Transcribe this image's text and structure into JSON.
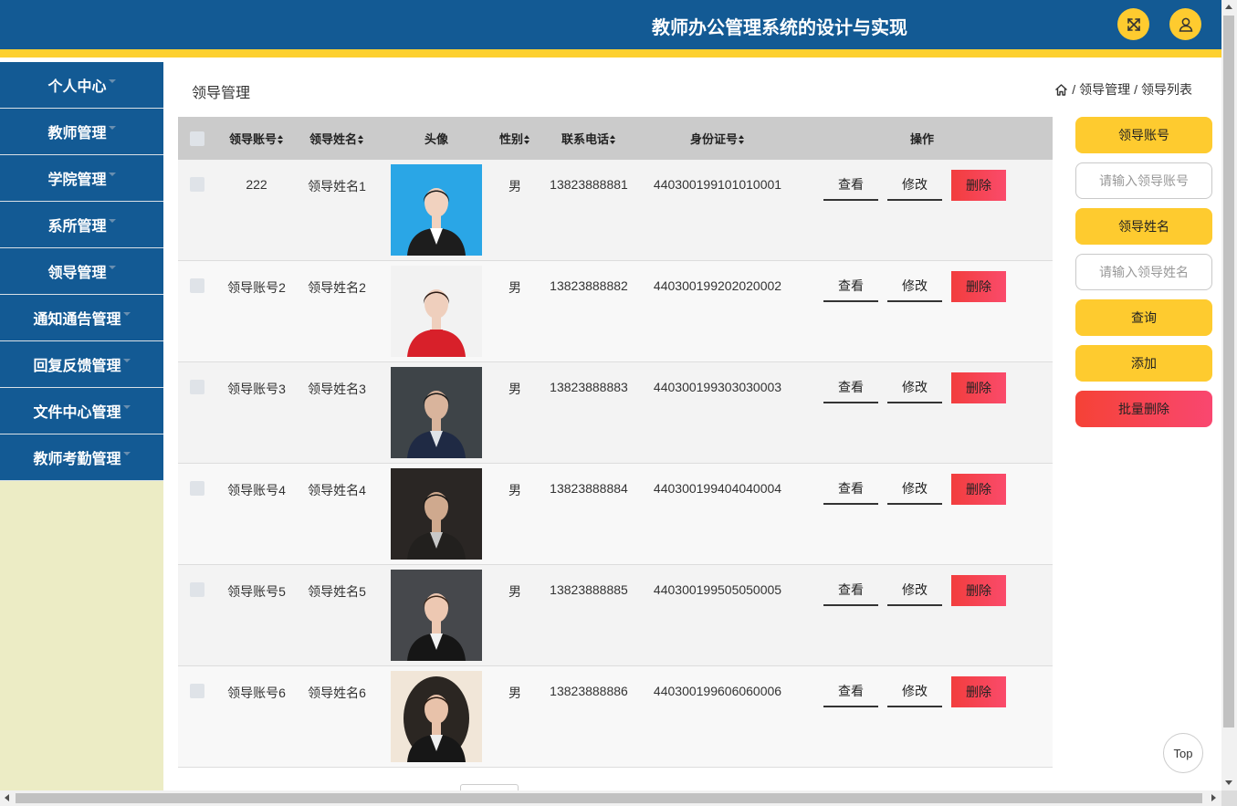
{
  "header": {
    "title": "教师办公管理系统的设计与实现",
    "fullscreen_icon": "fullscreen-icon",
    "user_icon": "user-icon",
    "bar_color": "#135a94",
    "accent_color": "#fdd02f"
  },
  "sidebar": {
    "items": [
      {
        "label": "个人中心"
      },
      {
        "label": "教师管理"
      },
      {
        "label": "学院管理"
      },
      {
        "label": "系所管理"
      },
      {
        "label": "领导管理"
      },
      {
        "label": "通知通告管理"
      },
      {
        "label": "回复反馈管理"
      },
      {
        "label": "文件中心管理"
      },
      {
        "label": "教师考勤管理"
      }
    ]
  },
  "main": {
    "page_title": "领导管理",
    "breadcrumb": [
      "领导管理",
      "领导列表"
    ],
    "breadcrumb_sep": "/",
    "table": {
      "headers": {
        "account": "领导账号",
        "name": "领导姓名",
        "avatar": "头像",
        "sex": "性别",
        "phone": "联系电话",
        "idcard": "身份证号",
        "ops": "操作"
      },
      "rows": [
        {
          "account": "222",
          "name": "领导姓名1",
          "sex": "男",
          "phone": "13823888881",
          "idcard": "440300199101010001"
        },
        {
          "account": "领导账号2",
          "name": "领导姓名2",
          "sex": "男",
          "phone": "13823888882",
          "idcard": "440300199202020002"
        },
        {
          "account": "领导账号3",
          "name": "领导姓名3",
          "sex": "男",
          "phone": "13823888883",
          "idcard": "440300199303030003"
        },
        {
          "account": "领导账号4",
          "name": "领导姓名4",
          "sex": "男",
          "phone": "13823888884",
          "idcard": "440300199404040004"
        },
        {
          "account": "领导账号5",
          "name": "领导姓名5",
          "sex": "男",
          "phone": "13823888885",
          "idcard": "440300199505050005"
        },
        {
          "account": "领导账号6",
          "name": "领导姓名6",
          "sex": "男",
          "phone": "13823888886",
          "idcard": "440300199606060006"
        }
      ],
      "actions": {
        "view": "查看",
        "edit": "修改",
        "delete": "删除"
      }
    }
  },
  "search_panel": {
    "account_label": "领导账号",
    "account_placeholder": "请输入领导账号",
    "name_label": "领导姓名",
    "name_placeholder": "请输入领导姓名",
    "query": "查询",
    "add": "添加",
    "batch_delete": "批量删除"
  },
  "back_to_top": "Top"
}
